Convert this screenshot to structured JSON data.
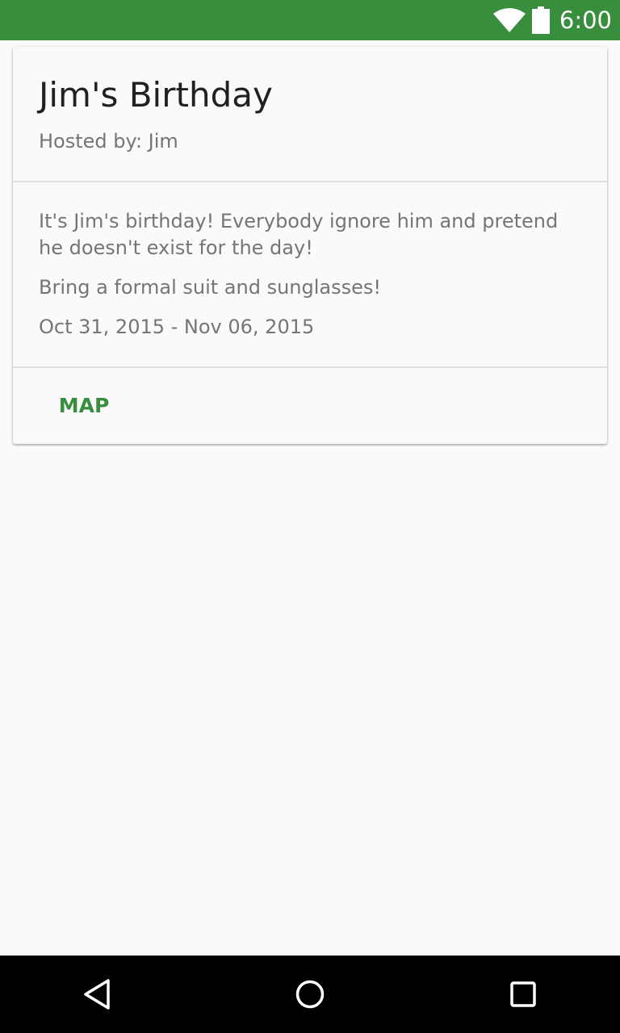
{
  "status_bar": {
    "time": "6:00",
    "icons": [
      "wifi-icon",
      "battery-icon"
    ],
    "color": "#388e3c"
  },
  "event": {
    "title": "Jim's Birthday",
    "host": "Hosted by: Jim",
    "description": "It's Jim's birthday! Everybody ignore him and pretend he doesn't exist for the day!",
    "note": "Bring a formal suit and sunglasses!",
    "dates": "Oct 31, 2015 - Nov 06, 2015",
    "map_label": "MAP"
  },
  "nav_bar": {
    "icons": [
      "back-icon",
      "home-icon",
      "recents-icon"
    ]
  },
  "colors": {
    "accent": "#388e3c",
    "title_text": "#212121",
    "secondary_text": "#757575",
    "background": "#fafafa"
  }
}
